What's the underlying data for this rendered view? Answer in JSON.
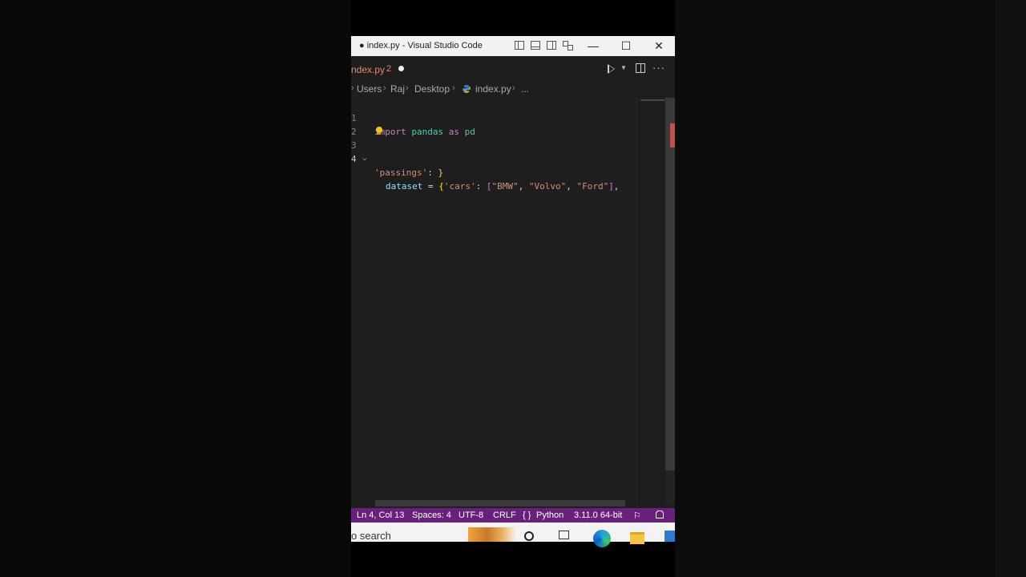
{
  "window": {
    "title": "● index.py - Visual Studio Code",
    "minimize": "—",
    "maximize": "☐",
    "close": "✕"
  },
  "tab": {
    "name": "ndex.py",
    "problems": "2"
  },
  "breadcrumb": {
    "items": [
      "Users",
      "Raj",
      "Desktop",
      "index.py",
      "..."
    ]
  },
  "code": {
    "line_numbers": [
      "1",
      "2",
      "3",
      "4"
    ],
    "lines": [
      [
        {
          "t": "import",
          "c": "kw"
        },
        {
          "t": " ",
          "c": "op"
        },
        {
          "t": "pandas",
          "c": "mod"
        },
        {
          "t": " ",
          "c": "op"
        },
        {
          "t": "as",
          "c": "kw"
        },
        {
          "t": " ",
          "c": "op"
        },
        {
          "t": "pd",
          "c": "mod"
        }
      ],
      [],
      [
        {
          "t": "dataset",
          "c": "var"
        },
        {
          "t": " = ",
          "c": "op"
        },
        {
          "t": "{",
          "c": "brk"
        },
        {
          "t": "'cars'",
          "c": "str"
        },
        {
          "t": ": ",
          "c": "op"
        },
        {
          "t": "[",
          "c": "brk2"
        },
        {
          "t": "\"BMW\"",
          "c": "str"
        },
        {
          "t": ", ",
          "c": "op"
        },
        {
          "t": "\"Volvo\"",
          "c": "str"
        },
        {
          "t": ", ",
          "c": "op"
        },
        {
          "t": "\"Ford\"",
          "c": "str"
        },
        {
          "t": "]",
          "c": "brk2"
        },
        {
          "t": ",",
          "c": "op"
        }
      ],
      [
        {
          "t": "'passings'",
          "c": "str"
        },
        {
          "t": ": ",
          "c": "op"
        },
        {
          "t": "}",
          "c": "brk"
        }
      ]
    ]
  },
  "status": {
    "position": "Ln 4, Col 13",
    "spaces": "Spaces: 4",
    "encoding": "UTF-8",
    "eol": "CRLF",
    "braces": "{ }",
    "language": "Python",
    "interpreter": "3.11.0 64-bit"
  },
  "taskbar": {
    "search": "o search"
  }
}
